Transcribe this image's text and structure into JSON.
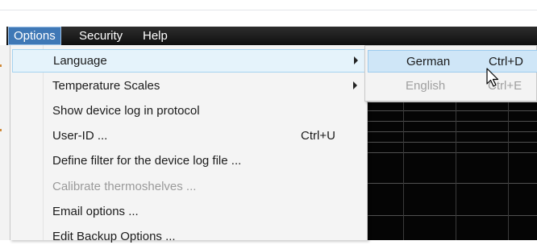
{
  "menubar": {
    "items": [
      {
        "label": "Options"
      },
      {
        "label": "Security"
      },
      {
        "label": "Help"
      }
    ]
  },
  "options_menu": {
    "items": [
      {
        "label": "Language",
        "shortcut": "",
        "has_submenu": true,
        "state": "highlighted"
      },
      {
        "label": "Temperature Scales",
        "shortcut": "",
        "has_submenu": true,
        "state": "normal"
      },
      {
        "label": "Show device log in protocol",
        "shortcut": "",
        "has_submenu": false,
        "state": "normal"
      },
      {
        "label": "User-ID ...",
        "shortcut": "Ctrl+U",
        "has_submenu": false,
        "state": "normal"
      },
      {
        "label": "Define filter for the device log file ...",
        "shortcut": "",
        "has_submenu": false,
        "state": "normal"
      },
      {
        "label": "Calibrate thermoshelves ...",
        "shortcut": "",
        "has_submenu": false,
        "state": "disabled"
      },
      {
        "label": "Email options ...",
        "shortcut": "",
        "has_submenu": false,
        "state": "normal"
      },
      {
        "label": "Edit Backup Options ...",
        "shortcut": "",
        "has_submenu": false,
        "state": "normal"
      }
    ]
  },
  "language_submenu": {
    "items": [
      {
        "label": "German",
        "shortcut": "Ctrl+D",
        "state": "highlighted"
      },
      {
        "label": "English",
        "shortcut": "Ctrl+E",
        "state": "disabled"
      }
    ]
  },
  "icons": {
    "submenu_arrow": "chevron-right-icon",
    "cursor": "mouse-pointer-icon"
  },
  "colors": {
    "menubar_bg": "#1a1a1a",
    "menu_active": "#3f78b6",
    "item_highlight": "#e5f3fb",
    "submenu_highlight": "#cfe6f7",
    "disabled_text": "#9a9a9a"
  }
}
